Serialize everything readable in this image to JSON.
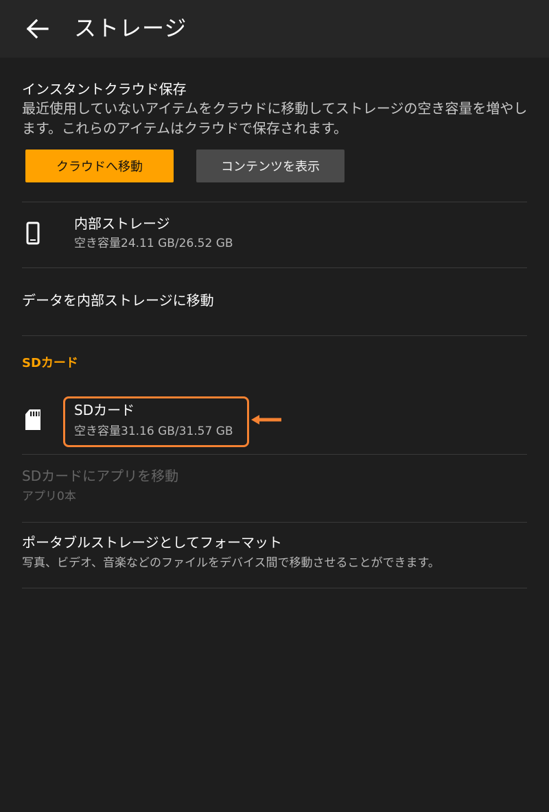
{
  "header": {
    "title": "ストレージ",
    "back_icon": "arrow-left-icon"
  },
  "cloud": {
    "title": "インスタントクラウド保存",
    "description": "最近使用していないアイテムをクラウドに移動してストレージの空き容量を増やします。これらのアイテムはクラウドで保存されます。",
    "move_button": "クラウドへ移動",
    "view_button": "コンテンツを表示"
  },
  "internal": {
    "icon": "phone-icon",
    "title": "内部ストレージ",
    "free_space": "空き容量24.11 GB/26.52 GB"
  },
  "move_to_internal": {
    "title": "データを内部ストレージに移動"
  },
  "sd_section": {
    "header": "SDカード",
    "icon": "sd-card-icon",
    "title": "SDカード",
    "free_space": "空き容量31.16 GB/31.57 GB"
  },
  "move_apps_sd": {
    "title": "SDカードにアプリを移動",
    "subtitle": "アプリ0本"
  },
  "format_portable": {
    "title": "ポータブルストレージとしてフォーマット",
    "subtitle": "写真、ビデオ、音楽などのファイルをデバイス間で移動させることができます。"
  },
  "colors": {
    "background": "#1e1e1e",
    "header": "#262626",
    "accent": "#ffa200",
    "annotation": "#f58232"
  }
}
